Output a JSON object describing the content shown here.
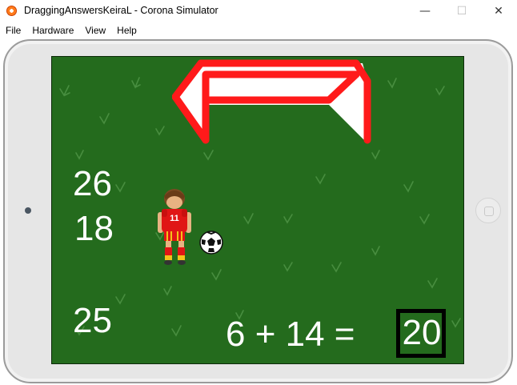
{
  "window": {
    "title": "DraggingAnswersKeiraL - Corona Simulator",
    "minimize_glyph": "—",
    "maximize_glyph": "☐",
    "close_glyph": "✕"
  },
  "menu": {
    "items": [
      {
        "label": "File"
      },
      {
        "label": "Hardware"
      },
      {
        "label": "View"
      },
      {
        "label": "Help"
      }
    ]
  },
  "game": {
    "answers": [
      {
        "value": "26"
      },
      {
        "value": "18"
      },
      {
        "value": "25"
      }
    ],
    "equation": "6 + 14 =",
    "answer_box": "20",
    "player_number": "11",
    "colors": {
      "field": "#246b1d",
      "goal_posts": "#ff1a1a",
      "jersey": "#e01515",
      "text": "#ffffff"
    }
  }
}
